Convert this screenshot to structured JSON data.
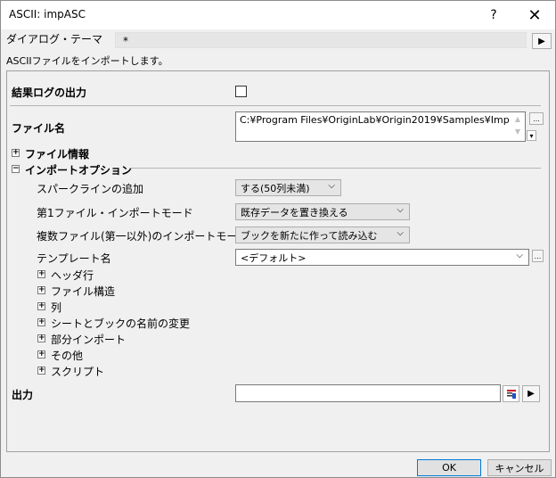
{
  "window": {
    "title": "ASCII: impASC",
    "help": "?",
    "close": "✕"
  },
  "theme": {
    "label": "ダイアログ・テーマ",
    "value": "*",
    "arrow": "▶"
  },
  "description": "ASCIIファイルをインポートします。",
  "result_log": {
    "label": "結果ログの出力",
    "checked": false
  },
  "filename": {
    "label": "ファイル名",
    "value": "C:¥Program Files¥OriginLab¥Origin2019¥Samples¥Imp",
    "browse": "...",
    "dropdown": "▾"
  },
  "file_info": {
    "toggle": "+",
    "label": "ファイル情報"
  },
  "import_options": {
    "toggle": "−",
    "label": "インポートオプション",
    "rows": [
      {
        "label": "スパークラインの追加",
        "value": "する(50列未満)"
      },
      {
        "label": "第1ファイル・インポートモード",
        "value": "既存データを置き換える"
      },
      {
        "label": "複数ファイル(第一以外)のインポートモード",
        "value": "ブックを新たに作って読み込む"
      }
    ],
    "template": {
      "label": "テンプレート名",
      "value": "<デフォルト>",
      "browse": "..."
    },
    "subgroups": [
      {
        "toggle": "+",
        "label": "ヘッダ行"
      },
      {
        "toggle": "+",
        "label": "ファイル構造"
      },
      {
        "toggle": "+",
        "label": "列"
      },
      {
        "toggle": "+",
        "label": "シートとブックの名前の変更"
      },
      {
        "toggle": "+",
        "label": "部分インポート"
      },
      {
        "toggle": "+",
        "label": "その他"
      },
      {
        "toggle": "+",
        "label": "スクリプト"
      }
    ]
  },
  "output": {
    "label": "出力",
    "value": "",
    "arrow": "▶"
  },
  "buttons": {
    "ok": "OK",
    "cancel": "キャンセル"
  },
  "chevron": "⌵"
}
